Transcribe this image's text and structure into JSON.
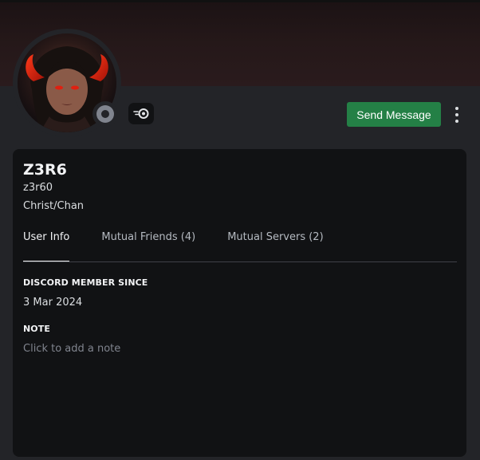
{
  "profile": {
    "display_name": "Z3R6",
    "username": "z3r60",
    "pronouns": "Christ/Chan",
    "status": "offline",
    "accent_color": "#248046"
  },
  "actions": {
    "send_message_label": "Send Message",
    "more_icon": "more-vertical-icon"
  },
  "tabs": [
    {
      "label": "User Info",
      "active": true
    },
    {
      "label": "Mutual Friends (4)",
      "active": false
    },
    {
      "label": "Mutual Servers (2)",
      "active": false
    }
  ],
  "user_info": {
    "member_since_title": "DISCORD MEMBER SINCE",
    "member_since_value": "3 Mar 2024",
    "note_title": "NOTE",
    "note_placeholder": "Click to add a note"
  }
}
